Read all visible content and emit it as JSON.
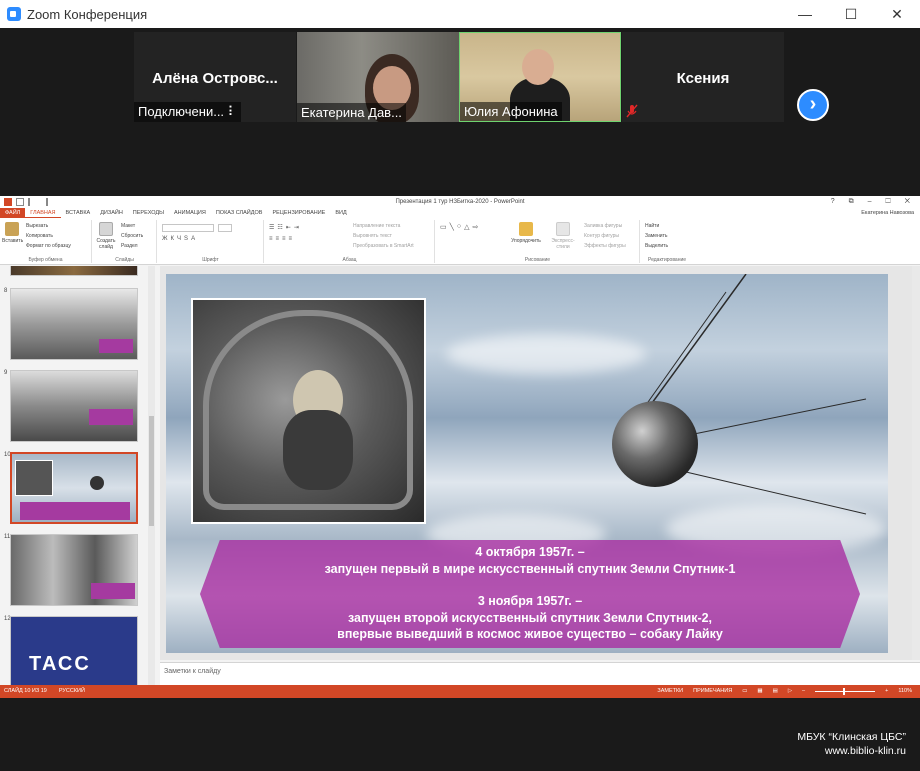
{
  "window": {
    "title": "Zoom Конференция",
    "controls": [
      "—",
      "☐",
      "✕"
    ]
  },
  "gallery": {
    "tiles": [
      {
        "name": "Алёна  Островс...",
        "label": "Подключени... ⠇",
        "video": false
      },
      {
        "name": "",
        "label": "Екатерина Дав...",
        "video": true
      },
      {
        "name": "",
        "label": "Юлия Афонина",
        "video": true,
        "active": true
      },
      {
        "name": "Ксения",
        "label": "",
        "video": false,
        "muted": true
      }
    ],
    "next_label": "›"
  },
  "powerpoint": {
    "doc_title": "Презентация 1 тур НЗБитка-2020 - PowerPoint",
    "window_controls": "? ⧉ – ☐ ✕",
    "user": "Екатерина Навозова",
    "tabs": [
      "ФАЙЛ",
      "ГЛАВНАЯ",
      "ВСТАВКА",
      "ДИЗАЙН",
      "ПЕРЕХОДЫ",
      "АНИМАЦИЯ",
      "ПОКАЗ СЛАЙДОВ",
      "РЕЦЕНЗИРОВАНИЕ",
      "ВИД"
    ],
    "ribbon": {
      "clipboard": {
        "paste": "Вставить",
        "cut": "Вырезать",
        "copy": "Копировать",
        "format": "Формат по образцу",
        "group": "Буфер обмена"
      },
      "slides": {
        "new": "Создать слайд",
        "layout": "Макет",
        "reset": "Сбросить",
        "section": "Раздел",
        "group": "Слайды"
      },
      "font": {
        "group": "Шрифт"
      },
      "paragraph": {
        "direction": "Направление текста",
        "align": "Выровнять текст",
        "smartart": "Преобразовать в SmartArt",
        "group": "Абзац"
      },
      "drawing": {
        "arrange": "Упорядочить",
        "styles": "Экспресс-стили",
        "fill": "Заливка фигуры",
        "outline": "Контур фигуры",
        "effects": "Эффекты фигуры",
        "group": "Рисование"
      },
      "editing": {
        "find": "Найти",
        "replace": "Заменить",
        "select": "Выделить",
        "group": "Редактирование"
      }
    },
    "thumbnails": [
      {
        "num": "8"
      },
      {
        "num": "9"
      },
      {
        "num": "10",
        "selected": true
      },
      {
        "num": "11"
      },
      {
        "num": "12",
        "text": "ТАСС"
      }
    ],
    "slide": {
      "line1": "4 октября 1957г. –",
      "line2": "запущен первый в мире искусственный спутник Земли Спутник-1",
      "line3": "3 ноября 1957г. –",
      "line4": "запущен второй искусственный спутник Земли Спутник-2,",
      "line5": "впервые выведший в космос живое существо – собаку Лайку"
    },
    "notes_placeholder": "Заметки к слайду",
    "status": {
      "slide": "СЛАЙД 10 ИЗ 19",
      "lang": "РУССКИЙ",
      "notes": "ЗАМЕТКИ",
      "comments": "ПРИМЕЧАНИЯ",
      "zoom": "110%"
    }
  },
  "watermark": {
    "line1": "МБУК “Клинская ЦБС”",
    "line2": "www.biblio-klin.ru"
  }
}
